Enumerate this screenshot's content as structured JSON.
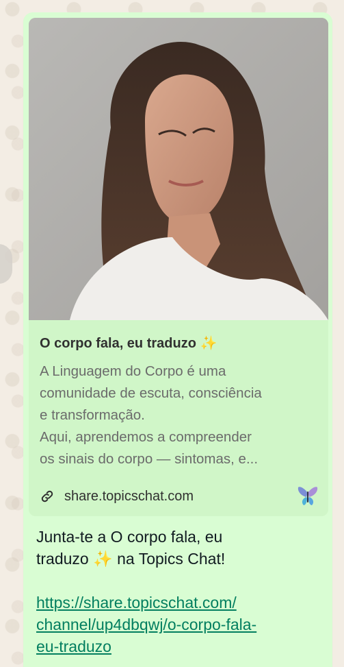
{
  "link_preview": {
    "image_alt": "Portrait of a woman with long dark hair wearing a white top and a gold necklace",
    "title": "O corpo fala, eu traduzo ✨",
    "description": "A Linguagem do Corpo é uma\ncomunidade de escuta, consciência\ne transformação.\nAqui, aprendemos a compreender\nos sinais do corpo — sintomas, e...",
    "domain": "share.topicschat.com",
    "domain_icon": "link-icon",
    "brand_icon": "topicschat-butterfly-logo"
  },
  "message": {
    "line1": "Junta-te a O corpo fala, eu",
    "line2": "traduzo ✨ na Topics Chat!",
    "url_line1": "https://share.topicschat.com/",
    "url_line2": "channel/up4dbqwj/o-corpo-fala-",
    "url_line3": "eu-traduzo"
  },
  "colors": {
    "bubble": "#d9fdd3",
    "link": "#027e5f",
    "wallpaper": "#efeae2"
  }
}
